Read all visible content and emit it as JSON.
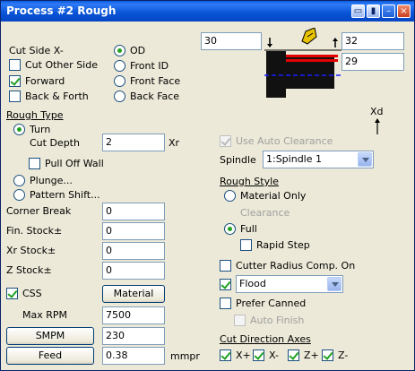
{
  "window": {
    "title": "Process #2 Rough"
  },
  "cut_side": {
    "label": "Cut Side X-",
    "other_side_label": "Cut Other Side",
    "forward_label": "Forward",
    "back_forth_label": "Back & Forth",
    "od_label": "OD",
    "front_id_label": "Front ID",
    "front_face_label": "Front Face",
    "back_face_label": "Back Face"
  },
  "diagram": {
    "left_value": "30",
    "right_top_value": "32",
    "right_bottom_value": "29",
    "axis_label": "Xd"
  },
  "rough_type": {
    "heading": "Rough Type",
    "turn_label": "Turn",
    "cut_depth_label": "Cut Depth",
    "cut_depth_value": "2",
    "cut_depth_unit": "Xr",
    "pull_off_wall_label": "Pull Off Wall",
    "plunge_label": "Plunge...",
    "pattern_shift_label": "Pattern Shift..."
  },
  "stock": {
    "corner_break_label": "Corner Break",
    "corner_break_value": "0",
    "fin_stock_label": "Fin. Stock±",
    "fin_stock_value": "0",
    "xr_stock_label": "Xr Stock±",
    "xr_stock_value": "0",
    "z_stock_label": "Z Stock±",
    "z_stock_value": "0"
  },
  "css": {
    "label": "CSS",
    "material_button": "Material",
    "max_rpm_label": "Max RPM",
    "max_rpm_value": "7500",
    "smpm_button": "SMPM",
    "smpm_value": "230",
    "feed_button": "Feed",
    "feed_value": "0.38",
    "feed_unit": "mmpr"
  },
  "right_panel": {
    "use_auto_clearance_label": "Use Auto Clearance",
    "spindle_label": "Spindle",
    "spindle_value": "1:Spindle 1",
    "rough_style_heading": "Rough Style",
    "material_only_label": "Material Only",
    "clearance_label": "Clearance",
    "full_label": "Full",
    "rapid_step_label": "Rapid Step",
    "cutter_radius_label": "Cutter Radius Comp. On",
    "coolant_value": "Flood",
    "prefer_canned_label": "Prefer Canned",
    "auto_finish_label": "Auto Finish",
    "cut_direction_heading": "Cut Direction Axes",
    "xplus_label": "X+",
    "xminus_label": "X-",
    "zplus_label": "Z+",
    "zminus_label": "Z-"
  }
}
